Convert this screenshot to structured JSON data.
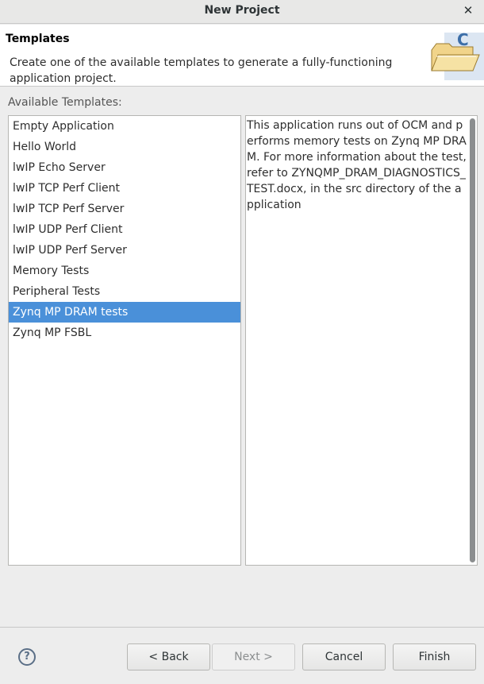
{
  "window": {
    "title": "New Project"
  },
  "header": {
    "title": "Templates",
    "description": "Create one of the available templates to generate a fully-functioning application project."
  },
  "available_label": "Available Templates:",
  "templates": [
    {
      "label": "Empty Application",
      "selected": false
    },
    {
      "label": "Hello World",
      "selected": false
    },
    {
      "label": "lwIP Echo Server",
      "selected": false
    },
    {
      "label": "lwIP TCP Perf Client",
      "selected": false
    },
    {
      "label": "lwIP TCP Perf Server",
      "selected": false
    },
    {
      "label": "lwIP UDP Perf Client",
      "selected": false
    },
    {
      "label": "lwIP UDP Perf Server",
      "selected": false
    },
    {
      "label": "Memory Tests",
      "selected": false
    },
    {
      "label": "Peripheral Tests",
      "selected": false
    },
    {
      "label": "Zynq MP DRAM tests",
      "selected": true
    },
    {
      "label": "Zynq MP FSBL",
      "selected": false
    }
  ],
  "description_text": "This application runs out of OCM and performs memory tests on Zynq MP DRAM.  For more information about the test, refer to ZYNQMP_DRAM_DIAGNOSTICS_TEST.docx, in the src directory of the application",
  "buttons": {
    "help": "?",
    "back": "< Back",
    "next": "Next >",
    "cancel": "Cancel",
    "finish": "Finish"
  },
  "icons": {
    "close": "close-icon",
    "wizard": "c-project-folder-icon",
    "help": "help-icon"
  },
  "colors": {
    "selection": "#4a90d9"
  }
}
